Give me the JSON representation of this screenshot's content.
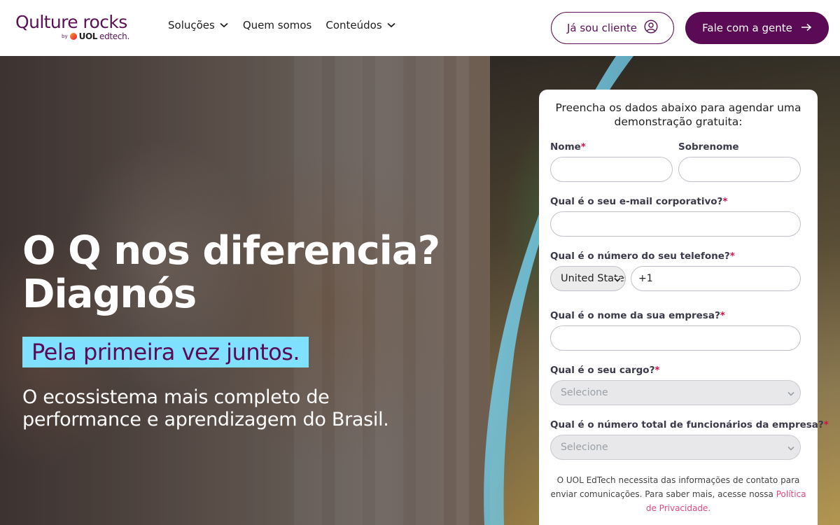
{
  "header": {
    "logo": {
      "main": "Qulture rocks",
      "by": "by",
      "uol": "UOL",
      "edtech": "edtech."
    },
    "nav": [
      {
        "label": "Soluções",
        "has_dropdown": true
      },
      {
        "label": "Quem somos",
        "has_dropdown": false
      },
      {
        "label": "Conteúdos",
        "has_dropdown": true
      }
    ],
    "client_button": "Já sou cliente",
    "contact_button": "Fale com a gente"
  },
  "hero": {
    "title_line1": "O Q nos diferencia?",
    "title_line2": "Diagnós",
    "tagline": "Pela primeira vez juntos.",
    "subtitle": "O ecossistema mais completo de performance e aprendizagem do Brasil."
  },
  "form": {
    "intro": "Preencha os dados abaixo para agendar uma demonstração gratuita:",
    "required_mark": "*",
    "fields": {
      "first_name": {
        "label": "Nome",
        "required": true,
        "value": ""
      },
      "last_name": {
        "label": "Sobrenome",
        "required": false,
        "value": ""
      },
      "email": {
        "label": "Qual é o seu e-mail corporativo?",
        "required": true,
        "value": ""
      },
      "phone": {
        "label": "Qual é o número do seu telefone?",
        "required": true,
        "country": "United States",
        "value": "+1"
      },
      "company": {
        "label": "Qual é o nome da sua empresa?",
        "required": true,
        "value": ""
      },
      "role": {
        "label": "Qual é o seu cargo?",
        "required": true,
        "value": "Selecione"
      },
      "employees": {
        "label": "Qual é o número total de funcionários da empresa?",
        "required": true,
        "value": "Selecione"
      }
    },
    "disclaimer_text": "O UOL EdTech necessita das informações de contato para enviar comunicações. Para saber mais, acesse nossa ",
    "privacy_link": "Política de Privacidade."
  },
  "colors": {
    "brand_purple": "#5b0a55",
    "accent_cyan": "#7fe0ff",
    "required_red": "#d0104c",
    "link_pink": "#e24a7a"
  },
  "icons": [
    "chevron-down-icon",
    "user-circle-icon",
    "arrow-right-icon"
  ]
}
